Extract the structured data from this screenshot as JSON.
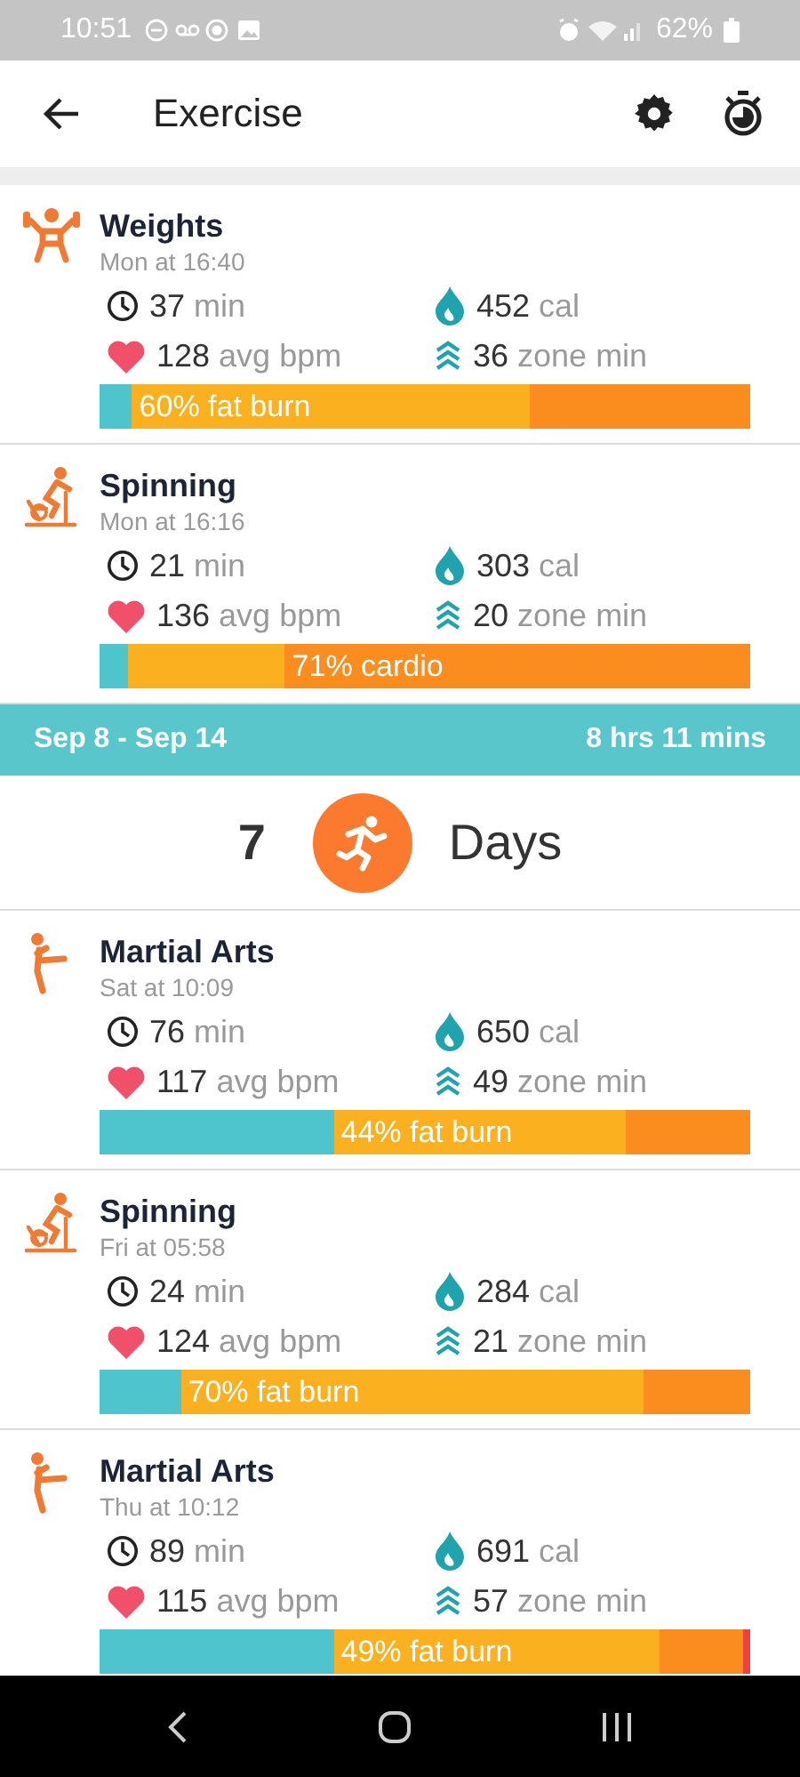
{
  "status_bar": {
    "time": "10:51",
    "battery": "62%"
  },
  "header": {
    "title": "Exercise"
  },
  "workouts_top": [
    {
      "kind": "weights",
      "name": "Weights",
      "when": "Mon at 16:40",
      "duration": "37",
      "duration_unit": "min",
      "calories": "452",
      "calories_unit": "cal",
      "heart_rate": "128",
      "heart_rate_unit": "avg bpm",
      "zone_minutes": "36",
      "zone_minutes_unit": "zone min",
      "zones": [
        {
          "color": "#4ec5cc"
        },
        {
          "color": "#fbb020",
          "label": "60% fat burn"
        },
        {
          "color": "#fb8c1e"
        }
      ]
    },
    {
      "kind": "spinning",
      "name": "Spinning",
      "when": "Mon at 16:16",
      "duration": "21",
      "duration_unit": "min",
      "calories": "303",
      "calories_unit": "cal",
      "heart_rate": "136",
      "heart_rate_unit": "avg bpm",
      "zone_minutes": "20",
      "zone_minutes_unit": "zone min",
      "zones": [
        {
          "color": "#4ec5cc"
        },
        {
          "color": "#fbb020"
        },
        {
          "color": "#fb8c1e",
          "label": "71% cardio"
        }
      ]
    }
  ],
  "week": {
    "range": "Sep 8 - Sep 14",
    "total": "8 hrs 11 mins",
    "count": "7",
    "unit": "Days"
  },
  "workouts_bottom": [
    {
      "kind": "martial_arts",
      "name": "Martial Arts",
      "when": "Sat at 10:09",
      "duration": "76",
      "duration_unit": "min",
      "calories": "650",
      "calories_unit": "cal",
      "heart_rate": "117",
      "heart_rate_unit": "avg bpm",
      "zone_minutes": "49",
      "zone_minutes_unit": "zone min",
      "zones": [
        {
          "color": "#4ec5cc"
        },
        {
          "color": "#fbb020",
          "label": "44% fat burn"
        },
        {
          "color": "#fb8c1e"
        }
      ]
    },
    {
      "kind": "spinning",
      "name": "Spinning",
      "when": "Fri at 05:58",
      "duration": "24",
      "duration_unit": "min",
      "calories": "284",
      "calories_unit": "cal",
      "heart_rate": "124",
      "heart_rate_unit": "avg bpm",
      "zone_minutes": "21",
      "zone_minutes_unit": "zone min",
      "zones": [
        {
          "color": "#4ec5cc"
        },
        {
          "color": "#fbb020",
          "label": "70% fat burn"
        },
        {
          "color": "#fb8c1e"
        }
      ]
    },
    {
      "kind": "martial_arts",
      "name": "Martial Arts",
      "when": "Thu at 10:12",
      "duration": "89",
      "duration_unit": "min",
      "calories": "691",
      "calories_unit": "cal",
      "heart_rate": "115",
      "heart_rate_unit": "avg bpm",
      "zone_minutes": "57",
      "zone_minutes_unit": "zone min",
      "zones": [
        {
          "color": "#4ec5cc"
        },
        {
          "color": "#fbb020",
          "label": "49% fat burn"
        },
        {
          "color": "#fb8c1e"
        },
        {
          "color": "#f0413c"
        }
      ]
    }
  ]
}
